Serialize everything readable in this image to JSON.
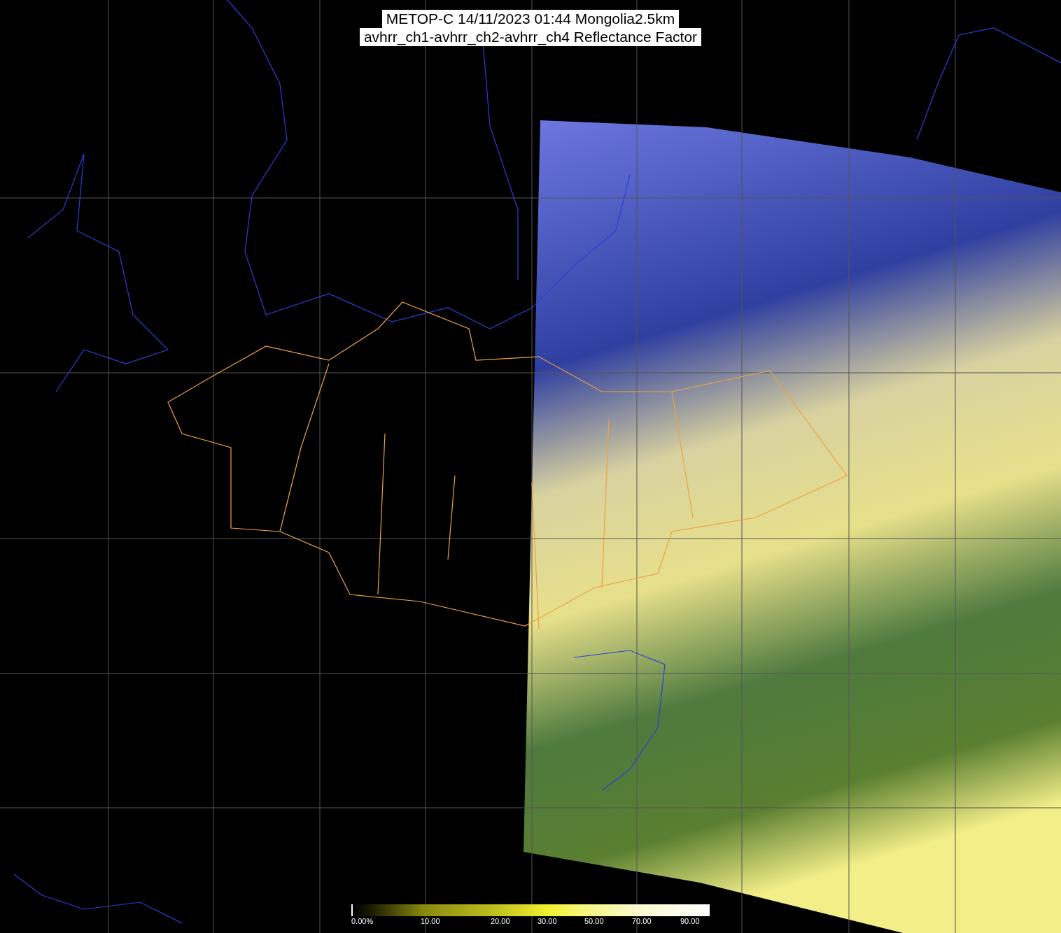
{
  "title": {
    "lines": [
      "METOP-C 14/11/2023 01:44 Mongolia2.5km",
      "avhrr_ch1-avhrr_ch2-avhrr_ch4 Reflectance Factor"
    ]
  },
  "color_bar": {
    "labels": [
      "0.00%",
      "10.00",
      "20.00",
      "30.00",
      "50.00",
      "70.00",
      "90.00"
    ]
  }
}
